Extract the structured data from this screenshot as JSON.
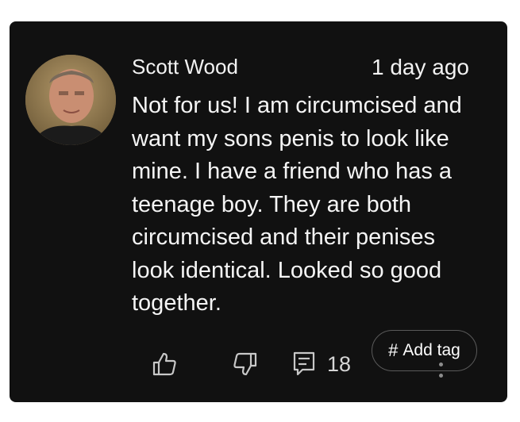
{
  "comment": {
    "author": "Scott Wood",
    "timestamp": "1 day ago",
    "text": "Not for us! I am circumcised and want my sons penis to look like mine. I have a friend who has a teenage boy. They are both circumcised and their penises look identical. Looked so good together.",
    "avatar_icon": "user-photo",
    "actions": {
      "like_icon": "thumbs-up-icon",
      "dislike_icon": "thumbs-down-icon",
      "reply_icon": "comment-icon",
      "reply_count": "18",
      "tag_symbol": "#",
      "tag_label": "Add tag",
      "more_icon": "more-vertical-icon"
    }
  },
  "colors": {
    "card_background": "#111111",
    "page_background": "#ffffff",
    "text": "#f5f5f5",
    "icon": "#c8c8c8"
  }
}
